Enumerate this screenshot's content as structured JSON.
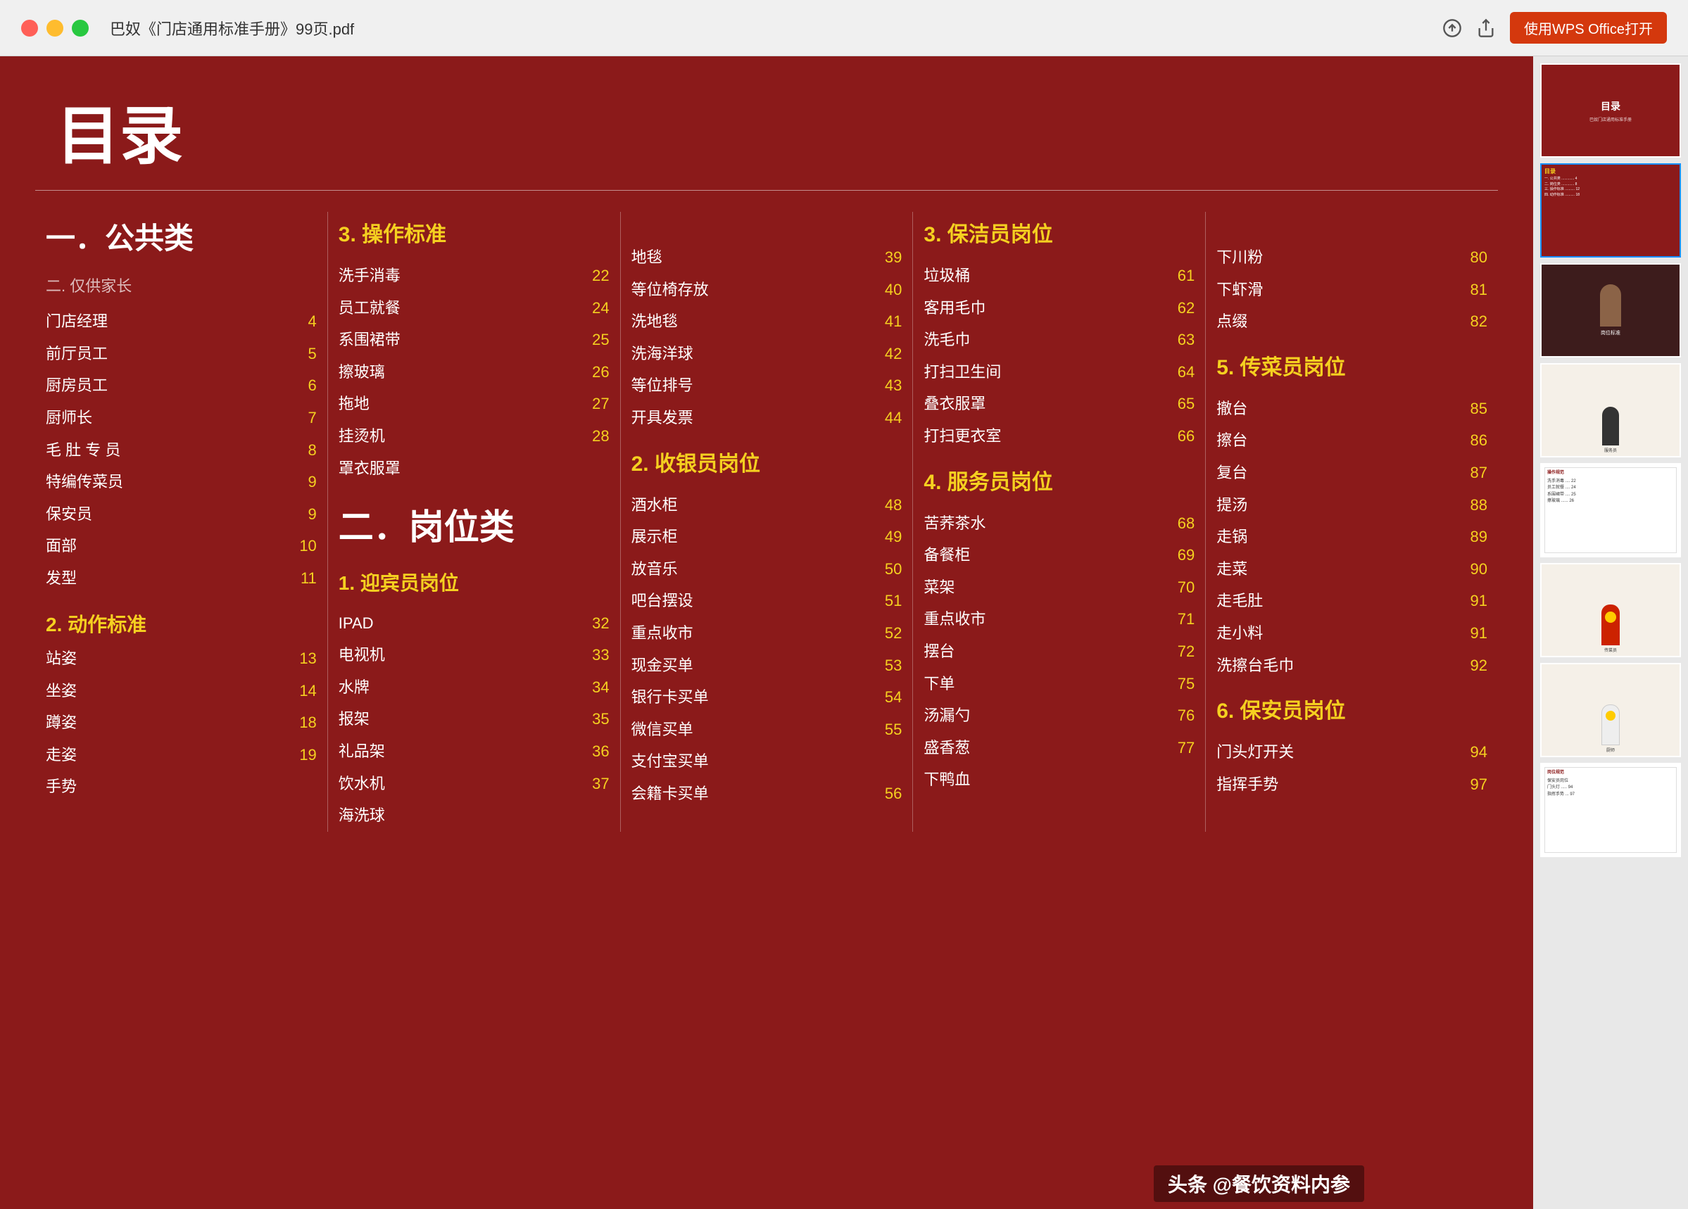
{
  "browser": {
    "tab_title": "巴奴《门店通用标准手册》99页.pdf",
    "wps_button": "使用WPS Office打开"
  },
  "toc": {
    "title": "目录",
    "sections": {
      "col1": {
        "header": "一．公共类",
        "subheader": "二. 仅供家长",
        "items": [
          {
            "name": "门店经理",
            "page": "4"
          },
          {
            "name": "前厅员工",
            "page": "5"
          },
          {
            "name": "厨房员工",
            "page": "6"
          },
          {
            "name": "厨师长",
            "page": "7"
          },
          {
            "name": "毛 肚 专 员",
            "page": "8"
          },
          {
            "name": "特编传菜员",
            "page": "9"
          },
          {
            "name": "保安员",
            "page": "9"
          },
          {
            "name": "面部",
            "page": "10"
          },
          {
            "name": "发型",
            "page": "11"
          }
        ],
        "section2_header": "2. 动作标准",
        "section2_items": [
          {
            "name": "站姿",
            "page": "13"
          },
          {
            "name": "坐姿",
            "page": "14"
          },
          {
            "name": "蹲姿",
            "page": "18"
          },
          {
            "name": "走姿",
            "page": "19"
          },
          {
            "name": "手势",
            "page": ""
          }
        ]
      },
      "col2": {
        "header": "3. 操作标准",
        "items": [
          {
            "name": "洗手消毒",
            "page": "22"
          },
          {
            "name": "员工就餐",
            "page": "24"
          },
          {
            "name": "系围裙带",
            "page": "25"
          },
          {
            "name": "擦玻璃",
            "page": "26"
          },
          {
            "name": "拖地",
            "page": "27"
          },
          {
            "name": "挂烫机",
            "page": "28"
          },
          {
            "name": "罩衣服罩",
            "page": ""
          }
        ],
        "section2_header": "二．岗位类",
        "section2_sub": "1. 迎宾员岗位",
        "section2_items": [
          {
            "name": "IPAD",
            "page": "32"
          },
          {
            "name": "电视机",
            "page": "33"
          },
          {
            "name": "水牌",
            "page": "34"
          },
          {
            "name": "报架",
            "page": "35"
          },
          {
            "name": "礼品架",
            "page": "36"
          },
          {
            "name": "饮水机",
            "page": "37"
          },
          {
            "name": "海洗球",
            "page": ""
          }
        ]
      },
      "col3": {
        "items": [
          {
            "name": "地毯",
            "page": "39"
          },
          {
            "name": "等位椅存放",
            "page": "40"
          },
          {
            "name": "洗地毯",
            "page": "41"
          },
          {
            "name": "洗海洋球",
            "page": "42"
          },
          {
            "name": "等位排号",
            "page": "43"
          },
          {
            "name": "开具发票",
            "page": "44"
          }
        ],
        "section2_header": "2. 收银员岗位",
        "section2_items": [
          {
            "name": "酒水柜",
            "page": "48"
          },
          {
            "name": "展示柜",
            "page": "49"
          },
          {
            "name": "放音乐",
            "page": "50"
          },
          {
            "name": "吧台摆设",
            "page": "51"
          },
          {
            "name": "重点收市",
            "page": "52"
          },
          {
            "name": "现金买单",
            "page": "53"
          },
          {
            "name": "银行卡买单",
            "page": "54"
          },
          {
            "name": "微信买单",
            "page": "55"
          },
          {
            "name": "支付宝买单",
            "page": ""
          },
          {
            "name": "会籍卡买单",
            "page": "56"
          }
        ]
      },
      "col4": {
        "header": "3. 保洁员岗位",
        "items": [
          {
            "name": "垃圾桶",
            "page": "61"
          },
          {
            "name": "客用毛巾",
            "page": "62"
          },
          {
            "name": "洗毛巾",
            "page": "63"
          },
          {
            "name": "打扫卫生间",
            "page": "64"
          },
          {
            "name": "叠衣服罩",
            "page": "65"
          },
          {
            "name": "打扫更衣室",
            "page": "66"
          }
        ],
        "section2_header": "4. 服务员岗位",
        "section2_items": [
          {
            "name": "苦荞茶水",
            "page": "68"
          },
          {
            "name": "备餐柜",
            "page": "69"
          },
          {
            "name": "菜架",
            "page": "70"
          },
          {
            "name": "重点收市",
            "page": "71"
          },
          {
            "name": "摆台",
            "page": "72"
          },
          {
            "name": "下单",
            "page": "75"
          },
          {
            "name": "汤漏勺",
            "page": "76"
          },
          {
            "name": "盛香葱",
            "page": "77"
          },
          {
            "name": "下鸭血",
            "page": ""
          }
        ]
      },
      "col5": {
        "items": [
          {
            "name": "下川粉",
            "page": "80"
          },
          {
            "name": "下虾滑",
            "page": "81"
          },
          {
            "name": "点缀",
            "page": "82"
          }
        ],
        "section2_header": "5. 传菜员岗位",
        "section2_items": [
          {
            "name": "撤台",
            "page": "85"
          },
          {
            "name": "擦台",
            "page": "86"
          },
          {
            "name": "复台",
            "page": "87"
          },
          {
            "name": "提汤",
            "page": "88"
          },
          {
            "name": "走锅",
            "page": "89"
          },
          {
            "name": "走菜",
            "page": "90"
          },
          {
            "name": "走毛肚",
            "page": "91"
          },
          {
            "name": "走小料",
            "page": "91"
          },
          {
            "name": "洗擦台毛巾",
            "page": "92"
          }
        ],
        "section3_header": "6. 保安员岗位",
        "section3_items": [
          {
            "name": "门头灯开关",
            "page": "94"
          },
          {
            "name": "指挥手势",
            "page": "97"
          }
        ]
      }
    }
  },
  "watermark": "头条 @餐饮资料内参",
  "thumbnails": [
    {
      "id": 1,
      "active": false,
      "type": "dark"
    },
    {
      "id": 2,
      "active": true,
      "type": "dark"
    },
    {
      "id": 3,
      "active": false,
      "type": "light"
    },
    {
      "id": 4,
      "active": false,
      "type": "light"
    },
    {
      "id": 5,
      "active": false,
      "type": "light"
    },
    {
      "id": 6,
      "active": false,
      "type": "light"
    },
    {
      "id": 7,
      "active": false,
      "type": "light"
    },
    {
      "id": 8,
      "active": false,
      "type": "light"
    }
  ]
}
